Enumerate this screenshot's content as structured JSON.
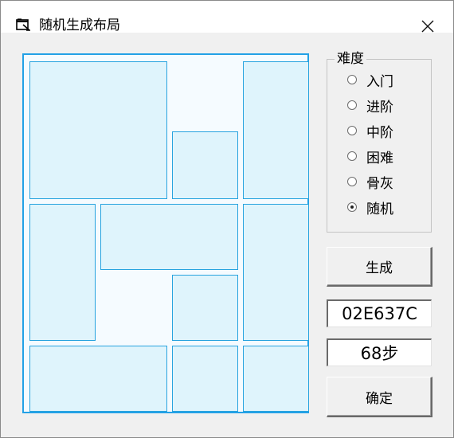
{
  "window": {
    "title": "随机生成布局",
    "icons": {
      "app": "app-window-icon",
      "close": "close-icon"
    }
  },
  "difficulty": {
    "legend": "难度",
    "options": [
      {
        "label": "入门",
        "checked": false
      },
      {
        "label": "进阶",
        "checked": false
      },
      {
        "label": "中阶",
        "checked": false
      },
      {
        "label": "困难",
        "checked": false
      },
      {
        "label": "骨灰",
        "checked": false
      },
      {
        "label": "随机",
        "checked": true
      }
    ]
  },
  "actions": {
    "generate_label": "生成",
    "confirm_label": "确定"
  },
  "result": {
    "code": "02E637C",
    "steps": "68步"
  },
  "colors": {
    "board_border": "#23a1e6",
    "tile_border": "#27a3df",
    "tile_fill": "#dff4fc",
    "board_background": "#f5fbff"
  }
}
